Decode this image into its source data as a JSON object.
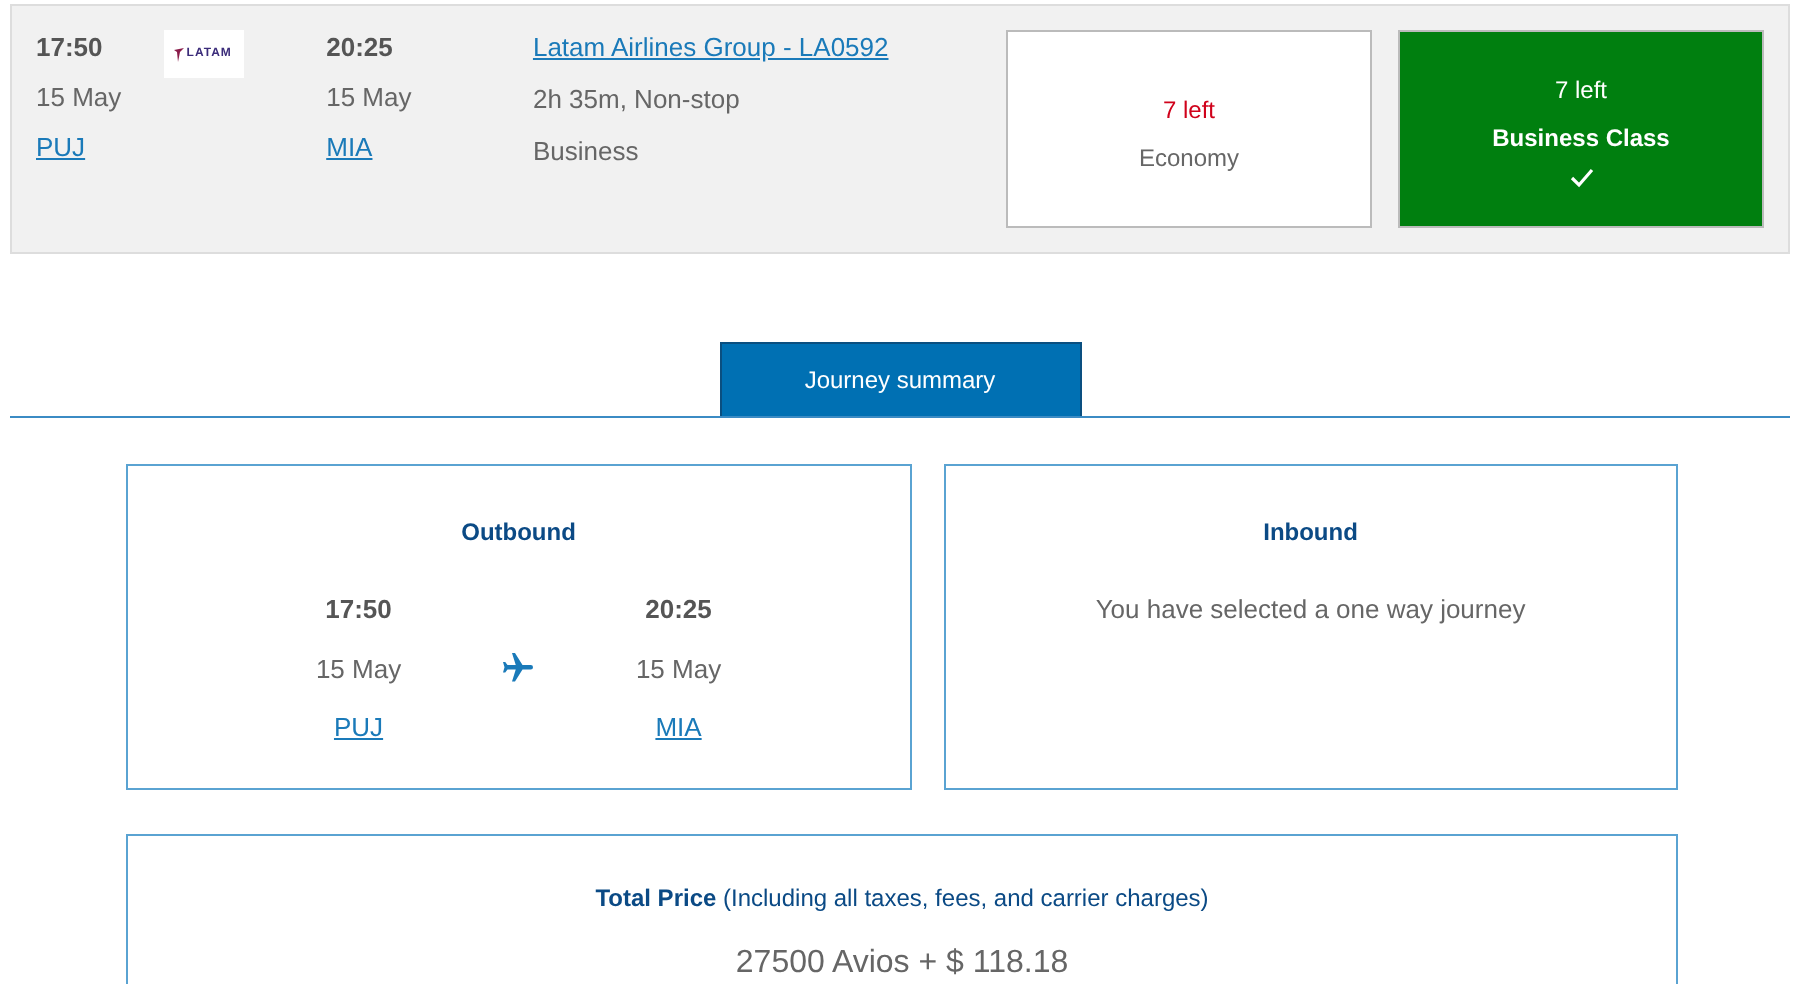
{
  "flight": {
    "departure": {
      "time": "17:50",
      "date": "15 May",
      "airport": "PUJ"
    },
    "airline_logo": "LATAM",
    "arrival": {
      "time": "20:25",
      "date": "15 May",
      "airport": "MIA"
    },
    "carrier_link": "Latam Airlines Group - LA0592",
    "duration": "2h 35m, Non-stop",
    "cabin": "Business",
    "fares": [
      {
        "seats": "7 left",
        "name": "Economy",
        "selected": false
      },
      {
        "seats": "7 left",
        "name": "Business Class",
        "selected": true
      }
    ]
  },
  "summary_tab": "Journey summary",
  "outbound": {
    "title": "Outbound",
    "departure": {
      "time": "17:50",
      "date": "15 May",
      "airport": "PUJ"
    },
    "arrival": {
      "time": "20:25",
      "date": "15 May",
      "airport": "MIA"
    }
  },
  "inbound": {
    "title": "Inbound",
    "message": "You have selected a one way journey"
  },
  "total": {
    "label": "**Total Price** (Including all taxes, fees, and carrier charges)",
    "amount": "27500 Avios + $ 118.18"
  }
}
